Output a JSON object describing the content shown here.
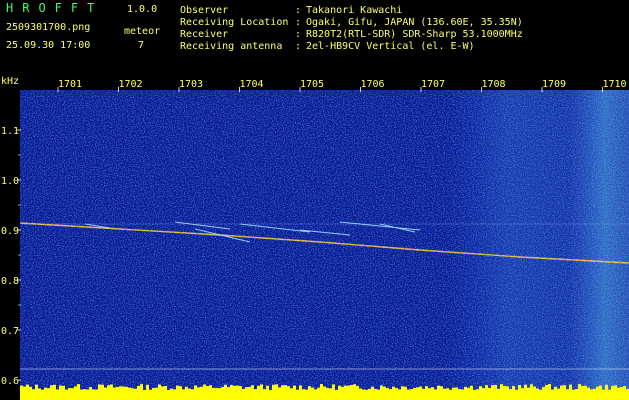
{
  "app": {
    "title": "HROFFT",
    "version": "1.0.0"
  },
  "file": {
    "name": "2509301700.png",
    "datetime": "25.09.30 17:00"
  },
  "meteor": {
    "label": "meteor",
    "count": "7"
  },
  "info": {
    "observer_label": "Observer",
    "observer": "Takanori Kawachi",
    "location_label": "Receiving Location",
    "location": "Ogaki, Gifu, JAPAN (136.60E, 35.35N)",
    "receiver_label": "Receiver",
    "receiver": "R820T2(RTL-SDR) SDR-Sharp 53.1000MHz",
    "antenna_label": "Receiving antenna",
    "antenna": "2el-HB9CV Vertical (el. E-W)"
  },
  "axis": {
    "unit": "kHz",
    "time_ticks": [
      "1701",
      "1702",
      "1703",
      "1704",
      "1705",
      "1706",
      "1707",
      "1708",
      "1709",
      "1710"
    ],
    "freq_ticks": [
      "1.1",
      "1.0",
      "0.9",
      "0.8",
      "0.7",
      "0.6"
    ],
    "freq_ticks_half": [
      "0.95",
      "0.85",
      "0.75",
      "0.65"
    ]
  },
  "colors": {
    "label": "#ffff66",
    "title": "#33ff66",
    "noise_base": "#0a1a8a",
    "noise_bright": "#3c8cff",
    "baseline_bar": "#ffff00"
  }
}
